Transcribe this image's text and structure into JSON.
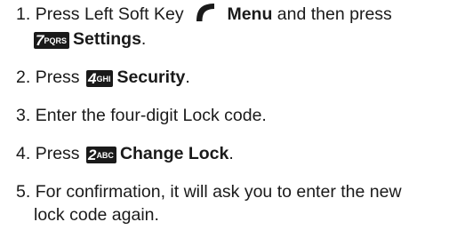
{
  "steps": [
    {
      "num": "1.",
      "pre": "Press Left Soft Key",
      "softkey_label": "Menu",
      "mid": "and then press",
      "key_digit": "7",
      "key_letters": "PQRS",
      "key_label": "Settings",
      "end": "."
    },
    {
      "num": "2.",
      "pre": "Press",
      "key_digit": "4",
      "key_letters": "GHI",
      "key_label": "Security",
      "end": "."
    },
    {
      "num": "3.",
      "text": "Enter the four-digit Lock code."
    },
    {
      "num": "4.",
      "pre": "Press",
      "key_digit": "2",
      "key_letters": "ABC",
      "key_label": "Change Lock",
      "end": "."
    },
    {
      "num": "5.",
      "line1": "For confirmation, it will ask you to enter the new",
      "line2": "lock code again."
    }
  ],
  "icons": {
    "softkey": "left-soft-key-icon"
  }
}
